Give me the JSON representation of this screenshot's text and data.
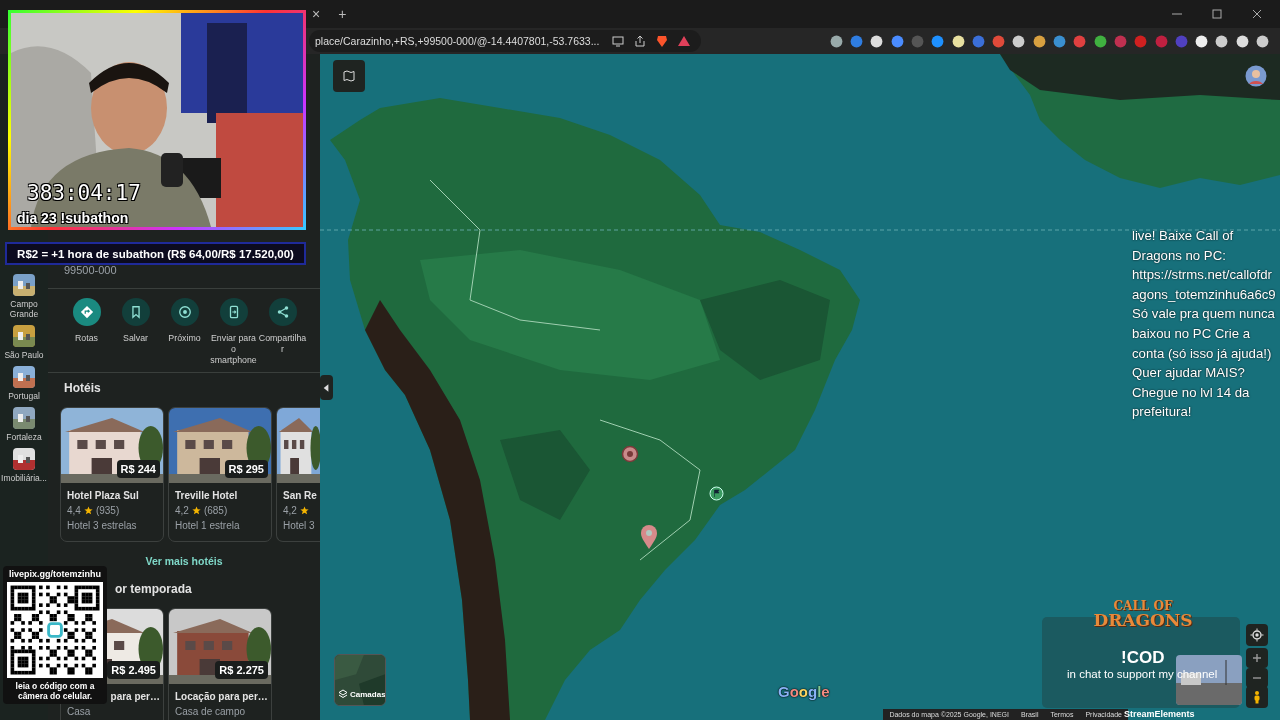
{
  "browser": {
    "tab_close": "×",
    "new_tab": "+",
    "address": "place/Carazinho,+RS,+99500-000/@-14.4407801,-53.7633..."
  },
  "webcam": {
    "timer": "383:04:17",
    "caption": "dia 23 !subathon"
  },
  "subathon_banner": "R$2 = +1 hora de subathon (R$ 64,00/R$ 17.520,00)",
  "recent_places": [
    {
      "label": "Campo Grande"
    },
    {
      "label": "São Paulo"
    },
    {
      "label": "Portugal"
    },
    {
      "label": "Fortaleza"
    },
    {
      "label": "Imobiliária..."
    }
  ],
  "place": {
    "postal_code": "99500-000"
  },
  "actions": [
    {
      "kind": "directions",
      "label": "Rotas"
    },
    {
      "kind": "save",
      "label": "Salvar"
    },
    {
      "kind": "nearby",
      "label": "Próximo"
    },
    {
      "kind": "send",
      "label": "Enviar para o smartphone"
    },
    {
      "kind": "share",
      "label": "Compartilhar"
    }
  ],
  "hotels": {
    "title": "Hotéis",
    "cards": [
      {
        "name": "Hotel Plaza Sul",
        "rating": "4,4",
        "reviews": "(935)",
        "category": "Hotel 3 estrelas",
        "price": "R$ 244"
      },
      {
        "name": "Treville Hotel",
        "rating": "4,2",
        "reviews": "(685)",
        "category": "Hotel 1 estrela",
        "price": "R$ 295"
      },
      {
        "name": "San Re",
        "rating": "4,2",
        "category": "Hotel 3"
      }
    ],
    "more": "Ver mais hotéis"
  },
  "vacation": {
    "title": "or temporada",
    "cards": [
      {
        "name": "para per…",
        "category": "Casa",
        "price": "R$ 2.495"
      },
      {
        "name": "Locação para per…",
        "category": "Casa de campo",
        "price": "R$ 2.275"
      }
    ]
  },
  "qr_overlay": {
    "url": "livepix.gg/totemzinhu",
    "caption": "leia o código com a câmera do celular."
  },
  "chat_message": "live! Baixe Call of Dragons no PC: https://strms.net/callofdragons_totemzinhu6a6c9 Só vale pra quem nunca baixou no PC Crie a conta (só isso já ajuda!) Quer ajudar MAIS? Chegue no lvl 14 da prefeitura!",
  "ad": {
    "logo_top": "CALL OF",
    "logo_bottom": "DRAGONS",
    "command": "!COD",
    "caption": "in chat to support my channel",
    "brand": "StreamElements"
  },
  "map": {
    "layers_label": "Camadas",
    "logo": "Google",
    "footer": [
      "Dados do mapa ©2025 Google, INEGI",
      "Brasil",
      "Termos",
      "Privacidade"
    ]
  }
}
